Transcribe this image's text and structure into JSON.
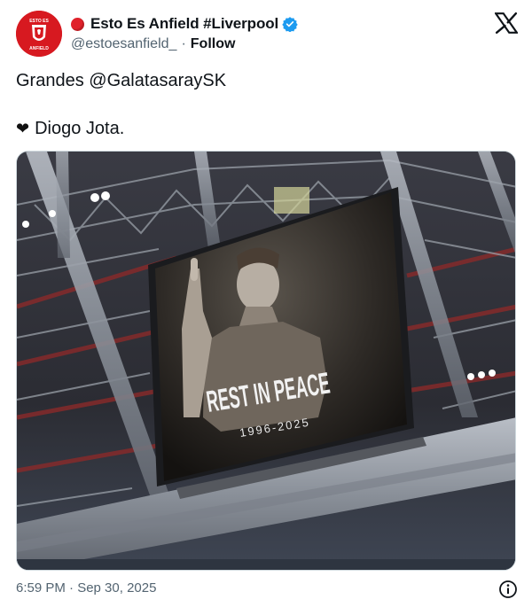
{
  "header": {
    "display_name": "Esto Es Anfield #Liverpool",
    "handle": "@estoesanfield_",
    "separator": "·",
    "follow_label": "Follow",
    "avatar_text": "ESTO ES ANFIELD",
    "accent_color": "#1d9bf0"
  },
  "tweet": {
    "line1": "Grandes @GalatasaraySK",
    "heart": "❤",
    "line2": "Diogo Jota."
  },
  "media": {
    "screen_title": "REST IN PEACE",
    "screen_years": "1996-2025"
  },
  "footer": {
    "timestamp": "6:59 PM · Sep 30, 2025"
  },
  "icons": [
    "verified-badge-icon",
    "x-logo-icon",
    "info-icon"
  ]
}
